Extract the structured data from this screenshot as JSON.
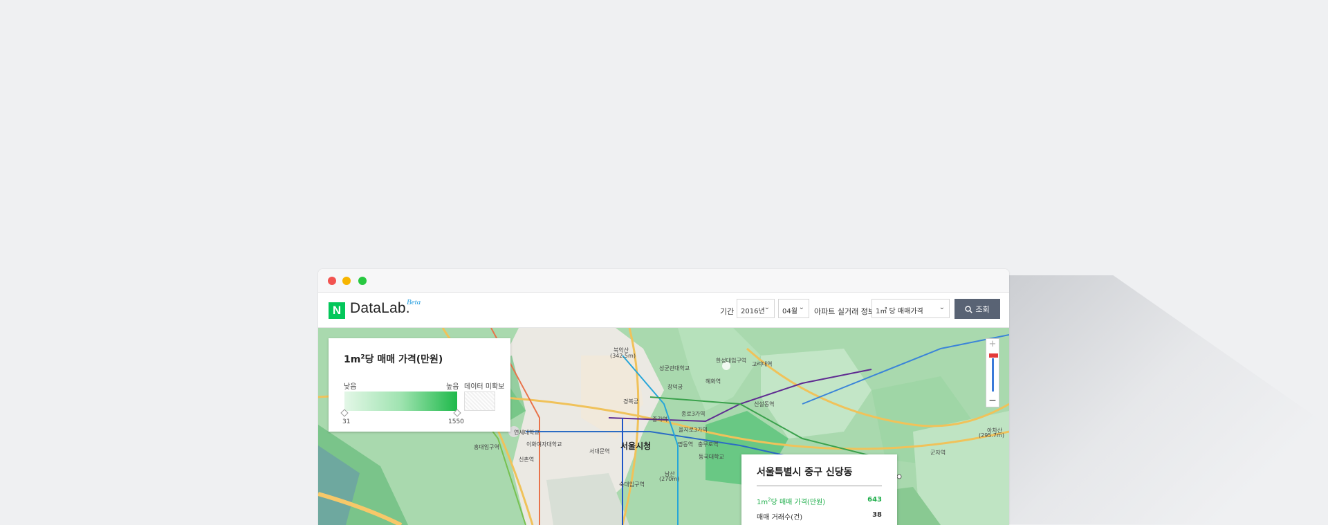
{
  "window": {
    "controls": [
      "close",
      "minimize",
      "maximize"
    ]
  },
  "header": {
    "logo_letter": "N",
    "logo_text": "DataLab.",
    "logo_badge": "Beta",
    "period_label": "기간",
    "year_value": "2016년",
    "month_value": "04월",
    "info_label": "아파트 실거래 정보",
    "metric_value": "1㎡ 당 매매가격",
    "search_label": "조회"
  },
  "legend": {
    "title_prefix": "1m",
    "title_sup": "2",
    "title_suffix": "당 매매 가격(만원)",
    "low_label": "낮음",
    "high_label": "높음",
    "nodata_label": "데이터 미확보",
    "min_value": "31",
    "max_value": "1550"
  },
  "info_panel": {
    "title": "서울특별시 중구 신당동",
    "price_label_prefix": "1m",
    "price_label_sup": "2",
    "price_label_suffix": "당 매매 가격(만원)",
    "price_value": "643",
    "count_label": "매매 거래수(건)",
    "count_value": "38"
  },
  "map": {
    "labels": {
      "seoul_city_hall": "서울시청",
      "bugaksan": "북악산",
      "bugaksan_height": "(342.5m)",
      "sungkyunkwan": "성균관대학교",
      "changdeokgung": "창덕궁",
      "gyeongbokgung": "경복궁",
      "hyehwa": "혜화역",
      "hansung": "한성대입구역",
      "korea_univ": "고려대역",
      "jongno3ga": "종로3가역",
      "jonggak": "종각역",
      "euljiro3ga": "을지로3가역",
      "myeongdong": "명동역",
      "chungmuro": "충무로역",
      "dongguk": "동국대학교",
      "seodaemun": "서대문역",
      "sinchon": "신촌역",
      "ewha": "이화여자대학교",
      "yonsei": "연세대학교",
      "namsan": "남산",
      "namsan_height": "(270m)",
      "achasan": "아차산",
      "achasan_height": "(295.7m)",
      "hongdae": "홍대입구역",
      "gunja": "군자역",
      "sinseol": "신설동역",
      "sookmyung": "숙대입구역"
    }
  }
}
